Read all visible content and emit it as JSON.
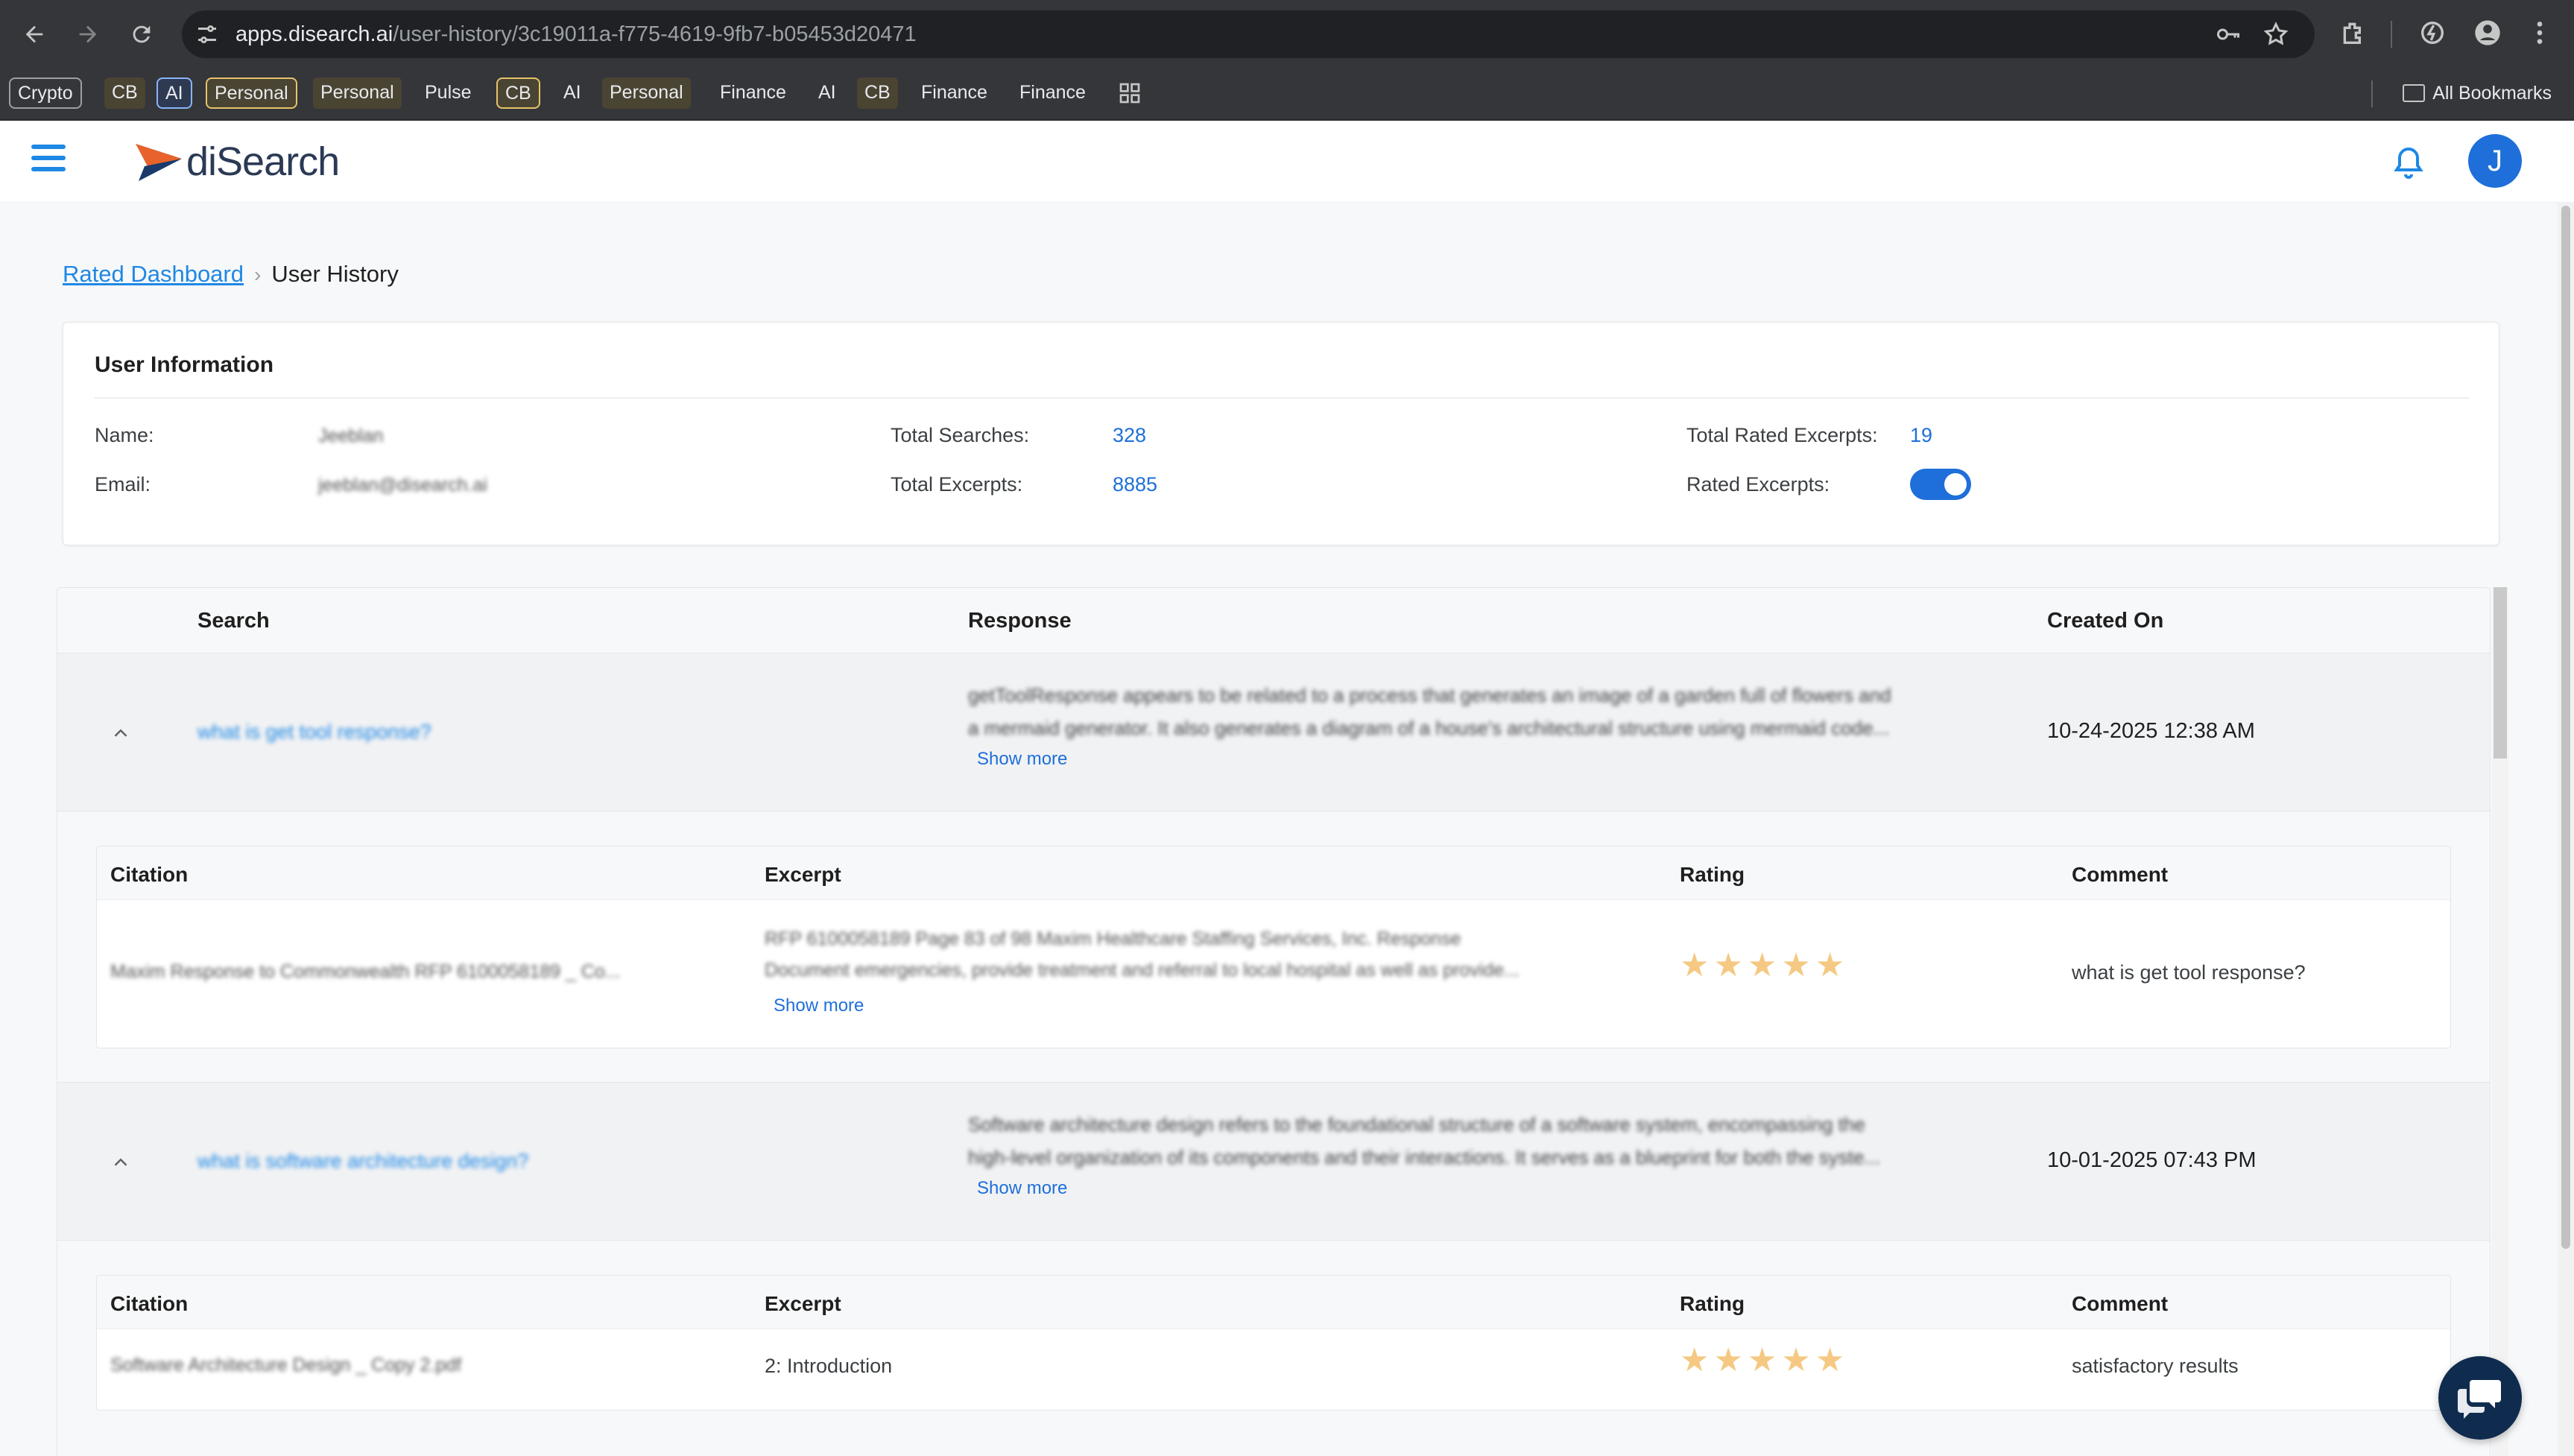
{
  "browser": {
    "url_host": "apps.disearch.ai",
    "url_path": "/user-history/3c19011a-f775-4619-9fb7-b05453d20471",
    "bookmarks": [
      {
        "label": "Crypto",
        "style": "boxed"
      },
      {
        "label": "CB",
        "style": "chip"
      },
      {
        "label": "AI",
        "style": "boxed-blue"
      },
      {
        "label": "Personal",
        "style": "boxed-yellow"
      },
      {
        "label": "Personal",
        "style": "chip"
      },
      {
        "label": "Pulse",
        "style": "plain"
      },
      {
        "label": "CB",
        "style": "boxed-yellow"
      },
      {
        "label": "AI",
        "style": "plain"
      },
      {
        "label": "Personal",
        "style": "chip"
      },
      {
        "label": "Finance",
        "style": "plain"
      },
      {
        "label": "AI",
        "style": "plain"
      },
      {
        "label": "CB",
        "style": "chip"
      },
      {
        "label": "Finance",
        "style": "plain"
      },
      {
        "label": "Finance",
        "style": "plain"
      }
    ],
    "all_bookmarks": "All Bookmarks"
  },
  "header": {
    "logo_text": "diSearch",
    "avatar_initial": "J"
  },
  "breadcrumb": {
    "parent": "Rated Dashboard",
    "separator": "›",
    "current": "User History"
  },
  "user_info": {
    "title": "User Information",
    "name_label": "Name:",
    "name_value": "Jeeblan",
    "email_label": "Email:",
    "email_value": "jeeblan@disearch.ai",
    "total_searches_label": "Total Searches:",
    "total_searches_value": "328",
    "total_excerpts_label": "Total Excerpts:",
    "total_excerpts_value": "8885",
    "total_rated_label": "Total Rated Excerpts:",
    "total_rated_value": "19",
    "rated_excerpts_label": "Rated Excerpts:",
    "rated_excerpts_on": true
  },
  "history": {
    "columns": {
      "search": "Search",
      "response": "Response",
      "created_on": "Created On"
    },
    "sub_columns": {
      "citation": "Citation",
      "excerpt": "Excerpt",
      "rating": "Rating",
      "comment": "Comment"
    },
    "rows": [
      {
        "search": "what is get tool response?",
        "response_line1": "getToolResponse appears to be related to a process that generates an image of a garden full of flowers and",
        "response_line2": "a mermaid generator. It also generates a diagram of a house's architectural structure using mermaid code...",
        "show_more": "Show more",
        "created_on": "10-24-2025 12:38 AM",
        "citation": {
          "source": "Maxim Response to Commonwealth RFP 6100058189 _ Co...",
          "excerpt_line1": "RFP 6100058189 Page 83 of 98 Maxim Healthcare Staffing Services, Inc. Response",
          "excerpt_line2": "Document emergencies, provide treatment and referral to local hospital as well as provide...",
          "show_more": "Show more",
          "rating": 5,
          "comment": "what is get tool response?"
        }
      },
      {
        "search": "what is software architecture design?",
        "response_line1": "Software architecture design refers to the foundational structure of a software system, encompassing the",
        "response_line2": "high-level organization of its components and their interactions. It serves as a blueprint for both the syste...",
        "show_more": "Show more",
        "created_on": "10-01-2025 07:43 PM",
        "citation": {
          "source": "Software Architecture Design _ Copy 2.pdf",
          "excerpt": "2: Introduction",
          "rating": 5,
          "comment": "satisfactory results"
        }
      }
    ]
  },
  "colors": {
    "accent": "#1e88e5",
    "star": "#f5c983",
    "chat_fab": "#0f2c4f"
  }
}
